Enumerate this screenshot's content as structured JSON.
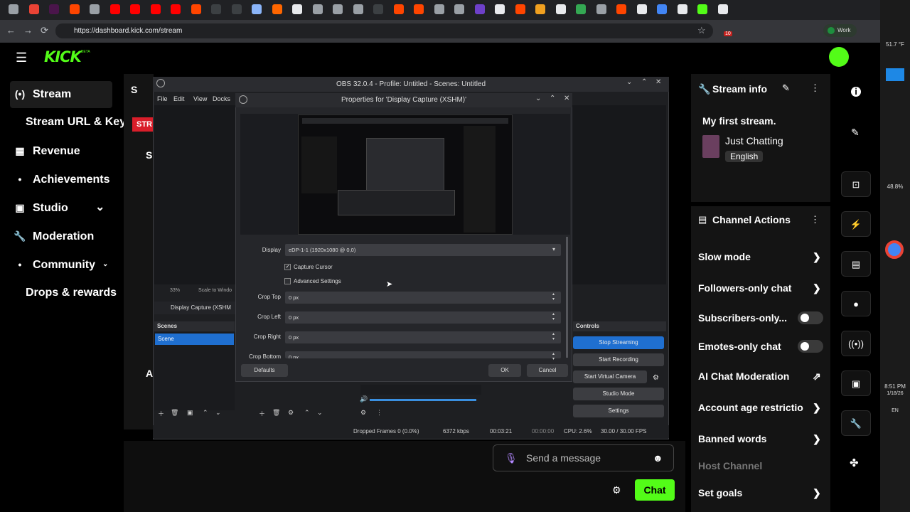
{
  "browser": {
    "url": "https://dashboard.kick.com/stream",
    "profile_label": "Work",
    "tab_colors": [
      "#9aa0a6",
      "#ea4335",
      "#4a154b",
      "#ff4500",
      "#9aa0a6",
      "#ff0000",
      "#ff0000",
      "#ff0000",
      "#ff0000",
      "#ff4500",
      "#3c4043",
      "#3c4043",
      "#8ab4f8",
      "#ff6600",
      "#e8eaed",
      "#9aa0a6",
      "#9aa0a6",
      "#9aa0a6",
      "#3c4043",
      "#ff4500",
      "#ff4500",
      "#9aa0a6",
      "#9aa0a6",
      "#6e40c9",
      "#e8eaed",
      "#ff4500",
      "#f0a020",
      "#e8eaed",
      "#34a853",
      "#9aa0a6",
      "#ff4500",
      "#e8eaed",
      "#4285f4",
      "#e8eaed",
      "#53fc18",
      "#e8eaed"
    ],
    "nav": {
      "back": "←",
      "forward": "→",
      "reload": "⟳",
      "star": "☆",
      "ext_badge": "10"
    }
  },
  "kick": {
    "logo": "KICK",
    "logo_sup": "BETA",
    "nav": [
      {
        "label": "Stream",
        "icon": "(•)"
      },
      {
        "label": "Stream URL & Key",
        "icon": ""
      },
      {
        "label": "Revenue",
        "icon": "▦"
      },
      {
        "label": "Achievements",
        "icon": "•"
      },
      {
        "label": "Studio",
        "icon": "▣",
        "chevron": "⌄"
      },
      {
        "label": "Moderation",
        "icon": "🔧"
      },
      {
        "label": "Community",
        "icon": "•",
        "chevron": "⌄"
      },
      {
        "label": "Drops & rewards",
        "icon": ""
      }
    ],
    "stream_info": {
      "title": "Stream info",
      "stream_title": "My first stream.",
      "category": "Just Chatting",
      "language": "English"
    },
    "channel_actions": {
      "title": "Channel Actions",
      "items": [
        {
          "label": "Slow mode",
          "control": "arrow"
        },
        {
          "label": "Followers-only chat",
          "control": "arrow"
        },
        {
          "label": "Subscribers-only...",
          "control": "toggle"
        },
        {
          "label": "Emotes-only chat",
          "control": "toggle"
        },
        {
          "label": "AI Chat Moderation",
          "control": "external"
        },
        {
          "label": "Account age restrictio",
          "control": "arrow"
        },
        {
          "label": "Banned words",
          "control": "arrow"
        },
        {
          "label": "Host Channel",
          "control": "none"
        },
        {
          "label": "Set goals",
          "control": "arrow"
        }
      ]
    },
    "chat": {
      "placeholder": "Send a message",
      "button": "Chat"
    },
    "center_partial": {
      "s1": "S",
      "s2": "S",
      "stream_btn": "STR",
      "a": "A"
    }
  },
  "obs": {
    "title": "OBS 32.0.4 - Profile: Untitled - Scenes: Untitled",
    "menu": [
      "File",
      "Edit",
      "View",
      "Docks"
    ],
    "zoom": "33%",
    "scale_label": "Scale to Windo",
    "source": "Display Capture (XSHM",
    "scenes_title": "Scenes",
    "scene_item": "Scene",
    "controls_title": "Controls",
    "controls": [
      "Stop Streaming",
      "Start Recording",
      "Start Virtual Camera",
      "Studio Mode",
      "Settings"
    ],
    "status": {
      "dropped": "Dropped Frames 0 (0.0%)",
      "bitrate": "6372 kbps",
      "live_time": "00:03:21",
      "rec_time": "00:00:00",
      "cpu": "CPU: 2.6%",
      "fps": "30.00 / 30.00 FPS"
    },
    "dialog": {
      "title": "Properties for 'Display Capture (XSHM)'",
      "display_label": "Display",
      "display_value": "eDP-1-1 (1920x1080 @ 0,0)",
      "capture_cursor": "Capture Cursor",
      "capture_cursor_checked": true,
      "advanced": "Advanced Settings",
      "advanced_checked": false,
      "crops": [
        {
          "label": "Crop Top",
          "value": "0 px"
        },
        {
          "label": "Crop Left",
          "value": "0 px"
        },
        {
          "label": "Crop Right",
          "value": "0 px"
        },
        {
          "label": "Crop Bottom",
          "value": "0 px"
        }
      ],
      "defaults": "Defaults",
      "ok": "OK",
      "cancel": "Cancel"
    }
  },
  "taskbar": {
    "weather": "51.7 °F",
    "battery": "48.8%",
    "time": "8:51 PM",
    "date": "1/18/26",
    "lang": "EN"
  }
}
